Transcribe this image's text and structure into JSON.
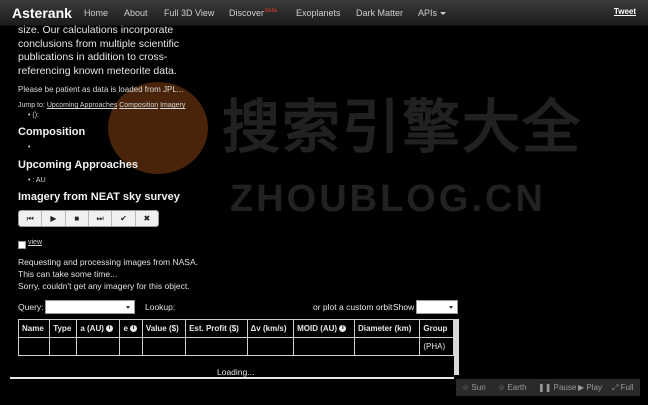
{
  "navbar": {
    "brand": "Asterank",
    "items": [
      "Home",
      "About",
      "Full 3D View",
      "Discover",
      "Exoplanets",
      "Dark Matter",
      "APIs"
    ],
    "beta_label": "beta",
    "tweet": "Tweet"
  },
  "intro": {
    "text": "size. Our calculations incorporate conclusions from multiple scientific publications in addition to cross-referencing known meteorite data.",
    "patient": "Please be patient as data is loaded from JPL...",
    "jump_label": "Jump to:",
    "jump_links": [
      "Upcoming Approaches",
      "Composition",
      "Imagery"
    ],
    "bullet_top": "():"
  },
  "sections": {
    "composition": "Composition",
    "approaches": "Upcoming Approaches",
    "approaches_bullet": ": AU",
    "imagery": "Imagery from NEAT sky survey"
  },
  "player": {
    "buttons": [
      {
        "name": "first-frame-icon",
        "glyph": "⏮"
      },
      {
        "name": "play-icon",
        "glyph": "▶"
      },
      {
        "name": "stop-icon",
        "glyph": "■"
      },
      {
        "name": "last-frame-icon",
        "glyph": "⏭"
      },
      {
        "name": "check-icon",
        "glyph": "✔"
      },
      {
        "name": "close-icon",
        "glyph": "✖"
      }
    ]
  },
  "view_link": "view",
  "messages": {
    "line1": "Requesting and processing images from NASA.",
    "line2": "This can take some time...",
    "line3": "Sorry, couldn't get any imagery for this object."
  },
  "search": {
    "query_label": "Query:",
    "lookup_label": "Lookup:",
    "custom_orbit": "or plot a custom orbit",
    "show_label": "Show"
  },
  "table": {
    "headers": [
      "Name",
      "Type",
      "a (AU)",
      "e",
      "Value ($)",
      "Est. Profit ($)",
      "Δv (km/s)",
      "MOID (AU)",
      "Diameter (km)",
      "Group"
    ],
    "headers_with_info": [
      2,
      3,
      7
    ],
    "row": [
      "",
      "",
      "",
      "",
      "",
      "",
      "",
      "",
      "",
      "(PHA)"
    ]
  },
  "loading": "Loading...",
  "controls": [
    "Sun",
    "Earth",
    "Pause",
    "Play",
    "Full"
  ],
  "watermark": {
    "cn": "搜索引擎大全",
    "en": "ZHOUBLOG.CN"
  }
}
